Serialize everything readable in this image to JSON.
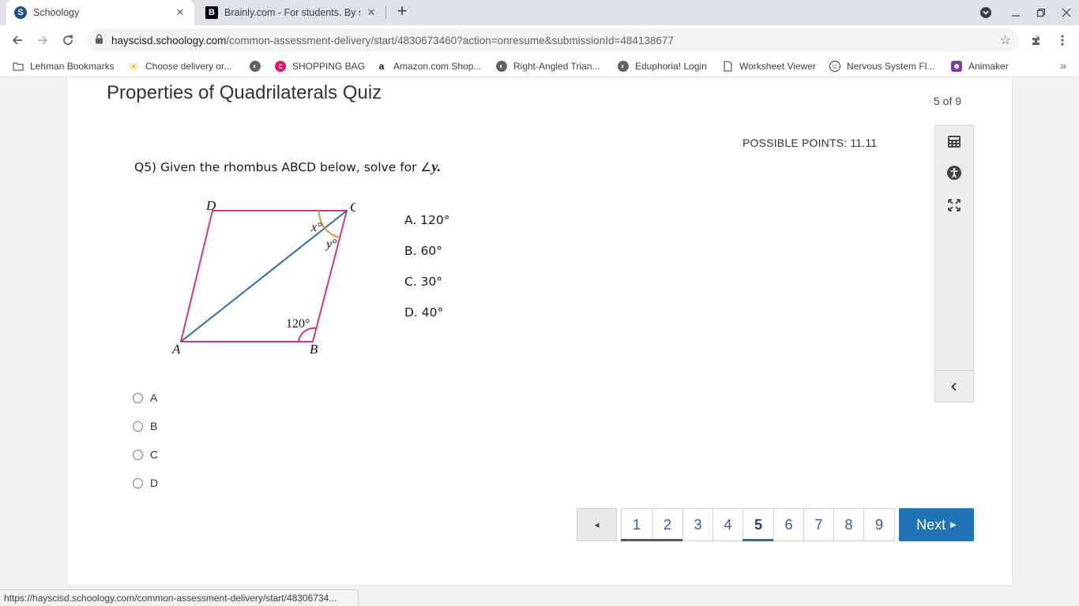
{
  "browser": {
    "tabs": [
      {
        "title": "Schoology",
        "favicon": "S",
        "favicon_color": "#1d4f91"
      },
      {
        "title": "Brainly.com - For students. By st",
        "favicon": "B",
        "favicon_color": "#000000"
      }
    ],
    "url_host": "hayscisd.schoology.com",
    "url_path": "/common-assessment-delivery/start/4830673460?action=onresume&submissionId=484138677",
    "bookmarks": [
      {
        "label": "Lehman Bookmarks",
        "icon": "folder-icon"
      },
      {
        "label": "Choose delivery or...",
        "icon": "walmart-icon"
      },
      {
        "label": "",
        "icon": "globe-icon"
      },
      {
        "label": "SHOPPING BAG",
        "icon": "shop-icon"
      },
      {
        "label": "Amazon.com Shop...",
        "icon": "amazon-icon"
      },
      {
        "label": "Right-Angled Trian...",
        "icon": "globe-icon"
      },
      {
        "label": "Eduphoria! Login",
        "icon": "globe-icon"
      },
      {
        "label": "Worksheet Viewer",
        "icon": "page-icon"
      },
      {
        "label": "Nervous System Fl...",
        "icon": "brain-icon"
      },
      {
        "label": "Animaker",
        "icon": "animaker-icon"
      }
    ],
    "status_url": "https://hayscisd.schoology.com/common-assessment-delivery/start/48306734..."
  },
  "quiz": {
    "title": "Properties of Quadrilaterals Quiz",
    "count": "5 of 9",
    "points": "POSSIBLE POINTS: 11.11",
    "question_prefix": "Q5) Given the rhombus ABCD below, solve for ∠",
    "question_var": "y",
    "question_suffix": ".",
    "figure": {
      "vertex_a": "A",
      "vertex_b": "B",
      "vertex_c": "C",
      "vertex_d": "D",
      "angle_x": "x°",
      "angle_y": "y°",
      "angle_b": "120°"
    },
    "choice_texts": [
      "A. 120°",
      "B. 60°",
      "C. 30°",
      "D. 40°"
    ],
    "answers": [
      "A",
      "B",
      "C",
      "D"
    ]
  },
  "pager": {
    "prev_symbol": "◂",
    "pages": [
      "1",
      "2",
      "3",
      "4",
      "5",
      "6",
      "7",
      "8",
      "9"
    ],
    "current": "5",
    "next_label": "Next"
  },
  "colors": {
    "accent": "#1f73b7",
    "rhombus": "#d63384",
    "diagonal": "#2a6fa8",
    "angle_arc": "#e08a2c"
  }
}
